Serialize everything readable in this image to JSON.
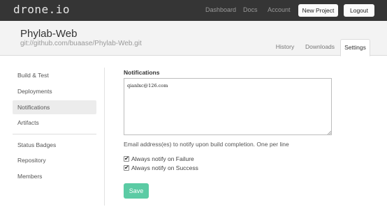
{
  "app": {
    "logo": "drone.io"
  },
  "topnav": {
    "links": [
      "Dashboard",
      "Docs",
      "Account"
    ],
    "new_project_label": "New Project",
    "logout_label": "Logout"
  },
  "project": {
    "title": "Phylab-Web",
    "repo": "git://github.com/buaase/Phylab-Web.git"
  },
  "tabs": [
    {
      "label": "History",
      "active": false
    },
    {
      "label": "Downloads",
      "active": false
    },
    {
      "label": "Settings",
      "active": true
    }
  ],
  "sidebar": {
    "items": [
      {
        "label": "Build & Test",
        "active": false
      },
      {
        "label": "Deployments",
        "active": false
      },
      {
        "label": "Notifications",
        "active": true
      },
      {
        "label": "Artifacts",
        "active": false
      },
      {
        "label": "Status Badges",
        "active": false
      },
      {
        "label": "Repository",
        "active": false
      },
      {
        "label": "Members",
        "active": false
      }
    ]
  },
  "notifications": {
    "title": "Notifications",
    "emails": "qianlxc@126.com",
    "help": "Email address(es) to notify upon build completion. One per line",
    "failure_label": "Always notify on Failure",
    "failure_checked": true,
    "success_label": "Always notify on Success",
    "success_checked": true,
    "save_label": "Save"
  },
  "colors": {
    "topbar": "#353535",
    "save_button": "#5bcba4",
    "header_band": "#f3f3f3"
  }
}
